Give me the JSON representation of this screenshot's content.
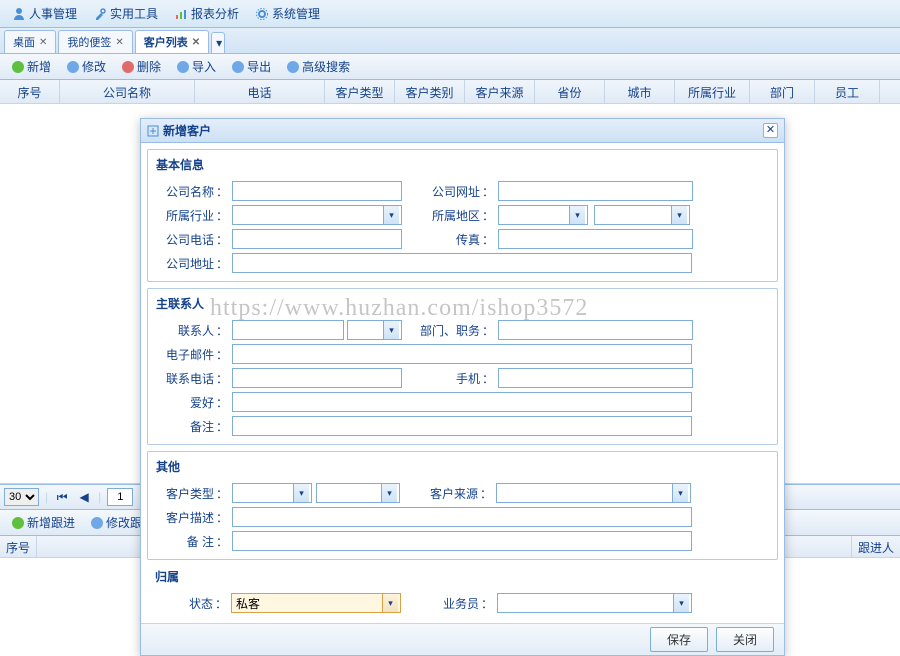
{
  "topmenu": [
    {
      "label": "人事管理",
      "icon": "user"
    },
    {
      "label": "实用工具",
      "icon": "tool"
    },
    {
      "label": "报表分析",
      "icon": "report"
    },
    {
      "label": "系统管理",
      "icon": "gear"
    }
  ],
  "tabs": [
    {
      "label": "桌面",
      "closable": true,
      "active": false
    },
    {
      "label": "我的便签",
      "closable": true,
      "active": false
    },
    {
      "label": "客户列表",
      "closable": true,
      "active": true
    }
  ],
  "toolbar": [
    {
      "label": "新增",
      "color": "#5fbf3f",
      "name": "add-button"
    },
    {
      "label": "修改",
      "color": "#6fa8e6",
      "name": "edit-button"
    },
    {
      "label": "删除",
      "color": "#e06b6b",
      "name": "delete-button"
    },
    {
      "label": "导入",
      "color": "#6fa8e6",
      "name": "import-button"
    },
    {
      "label": "导出",
      "color": "#6fa8e6",
      "name": "export-button"
    },
    {
      "label": "高级搜索",
      "color": "#6fa8e6",
      "name": "advsearch-button"
    }
  ],
  "grid_columns": [
    {
      "label": "序号",
      "w": 60
    },
    {
      "label": "公司名称",
      "w": 135
    },
    {
      "label": "电话",
      "w": 130
    },
    {
      "label": "客户类型",
      "w": 70
    },
    {
      "label": "客户类别",
      "w": 70
    },
    {
      "label": "客户来源",
      "w": 70
    },
    {
      "label": "省份",
      "w": 70
    },
    {
      "label": "城市",
      "w": 70
    },
    {
      "label": "所属行业",
      "w": 75
    },
    {
      "label": "部门",
      "w": 65
    },
    {
      "label": "员工",
      "w": 65
    }
  ],
  "pager": {
    "page_size": "30",
    "page": "1"
  },
  "toolbar2": [
    {
      "label": "新增跟进",
      "color": "#5fbf3f",
      "name": "add-follow-button"
    },
    {
      "label": "修改跟进",
      "color": "#6fa8e6",
      "name": "edit-follow-button"
    }
  ],
  "grid2": {
    "left": "序号",
    "right": "跟进人"
  },
  "dialog": {
    "title": "新增客户",
    "sections": {
      "basic": {
        "legend": "基本信息",
        "company_name_lbl": "公司名称",
        "website_lbl": "公司网址",
        "industry_lbl": "所属行业",
        "region_lbl": "所属地区",
        "phone_lbl": "公司电话",
        "fax_lbl": "传真",
        "address_lbl": "公司地址"
      },
      "contact": {
        "legend": "主联系人",
        "name_lbl": "联系人",
        "dept_lbl": "部门、职务",
        "email_lbl": "电子邮件",
        "tel_lbl": "联系电话",
        "mobile_lbl": "手机",
        "hobby_lbl": "爱好",
        "remark_lbl": "备注"
      },
      "other": {
        "legend": "其他",
        "type_lbl": "客户类型",
        "source_lbl": "客户来源",
        "desc_lbl": "客户描述",
        "note_lbl": "备 注"
      },
      "belong": {
        "legend": "归属",
        "status_lbl": "状态",
        "status_value": "私客",
        "sales_lbl": "业务员"
      }
    },
    "save_btn": "保存",
    "close_btn": "关闭"
  },
  "watermark": "https://www.huzhan.com/ishop3572"
}
